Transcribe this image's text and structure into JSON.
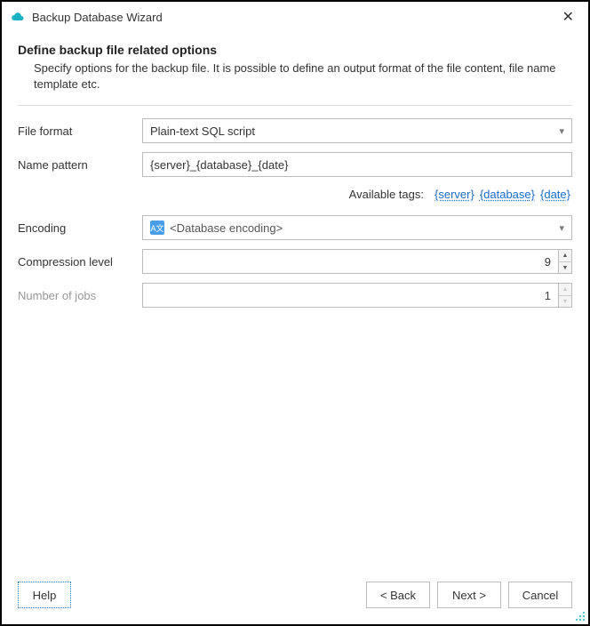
{
  "window": {
    "title": "Backup Database Wizard"
  },
  "page": {
    "heading": "Define backup file related options",
    "subheading": "Specify options for the backup file. It is possible to define an output format of the file content, file name template etc."
  },
  "fields": {
    "file_format": {
      "label": "File format",
      "value": "Plain-text SQL script"
    },
    "name_pattern": {
      "label": "Name pattern",
      "value": "{server}_{database}_{date}"
    },
    "tags": {
      "label": "Available tags:",
      "server": "{server}",
      "database": "{database}",
      "date": "{date}"
    },
    "encoding": {
      "label": "Encoding",
      "value": "<Database encoding>"
    },
    "compression": {
      "label": "Compression level",
      "value": "9"
    },
    "jobs": {
      "label": "Number of jobs",
      "value": "1"
    }
  },
  "buttons": {
    "help": "Help",
    "back": "< Back",
    "next": "Next >",
    "cancel": "Cancel"
  }
}
